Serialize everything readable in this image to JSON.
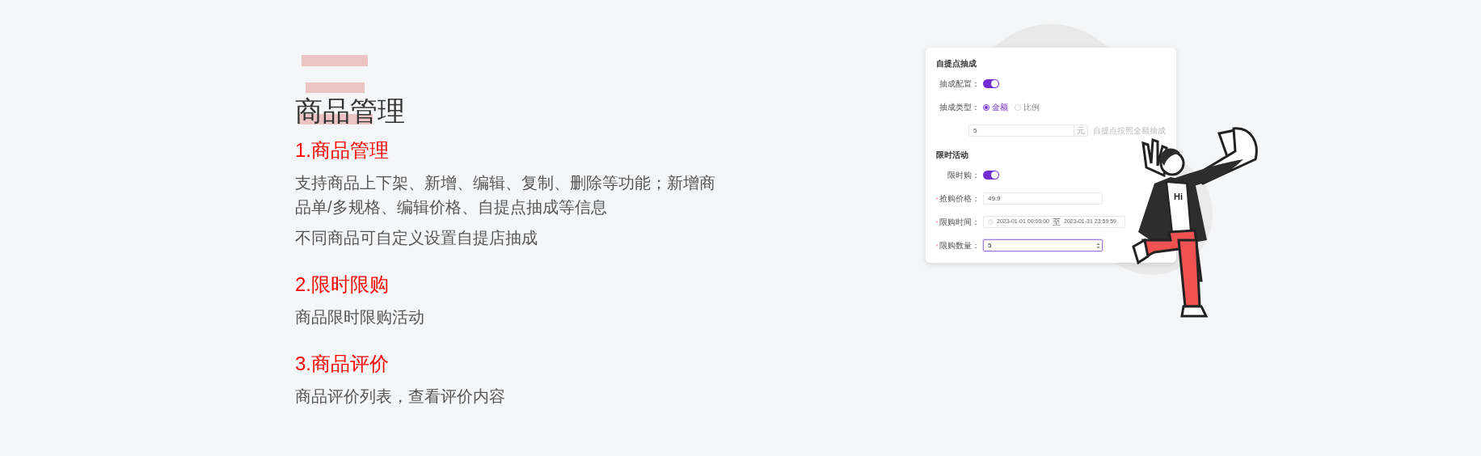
{
  "hero": {
    "title": "商品管理"
  },
  "features": [
    {
      "heading": "1.商品管理",
      "lines": [
        "支持商品上下架、新增、编辑、复制、删除等功能；新增商品单/多规格、编辑价格、自提点抽成等信息",
        "不同商品可自定义设置自提店抽成"
      ]
    },
    {
      "heading": "2.限时限购",
      "lines": [
        "商品限时限购活动"
      ]
    },
    {
      "heading": "3.商品评价",
      "lines": [
        "商品评价列表，查看评价内容"
      ]
    }
  ],
  "preview": {
    "sections": [
      {
        "title": "自提点抽成",
        "fields": [
          {
            "kind": "toggle",
            "label": "抽成配置：",
            "required": false,
            "on": true
          },
          {
            "kind": "radio",
            "label": "抽成类型：",
            "required": false,
            "options": [
              {
                "label": "金额",
                "selected": true
              },
              {
                "label": "比例",
                "selected": false
              }
            ]
          },
          {
            "kind": "suffix_input",
            "value": "5",
            "suffix": "元",
            "hint": "自提点按照全额抽成"
          }
        ]
      },
      {
        "title": "限时活动",
        "fields": [
          {
            "kind": "toggle",
            "label": "限时购：",
            "required": false,
            "on": true
          },
          {
            "kind": "input",
            "label": "抢购价格：",
            "required": true,
            "value": "49.9"
          },
          {
            "kind": "date_range",
            "label": "限购时间：",
            "required": true,
            "start": "2023-01-01 00:00:00",
            "separator": "至",
            "end": "2023-01-31 23:59:59"
          },
          {
            "kind": "number",
            "label": "限购数量：",
            "required": true,
            "value": "5",
            "focused": true
          }
        ]
      }
    ]
  },
  "illustration": {
    "shirt_text": "Hi"
  }
}
